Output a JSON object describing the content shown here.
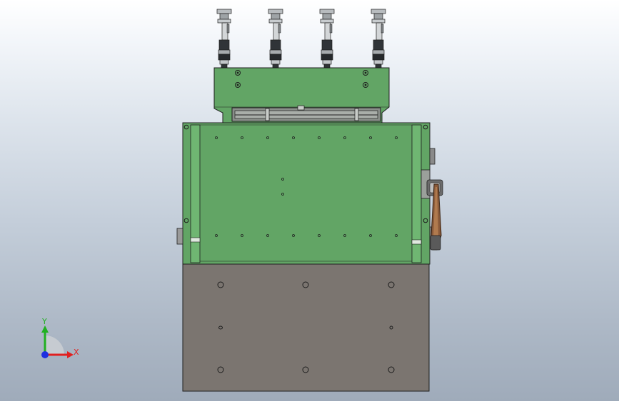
{
  "viewport": {
    "background_top": "#ffffff",
    "background_bottom": "#9fabba"
  },
  "model": {
    "top_plate_color": "#62a565",
    "frame_color": "#62a565",
    "base_color": "#7b7570",
    "edge_color": "#1e1e1e",
    "belt_color": "#8a5a3a",
    "valve_count": 4
  },
  "triad": {
    "x_label": "X",
    "y_label": "Y",
    "x_color": "#e02020",
    "y_color": "#20b020",
    "z_color": "#2030e0"
  }
}
